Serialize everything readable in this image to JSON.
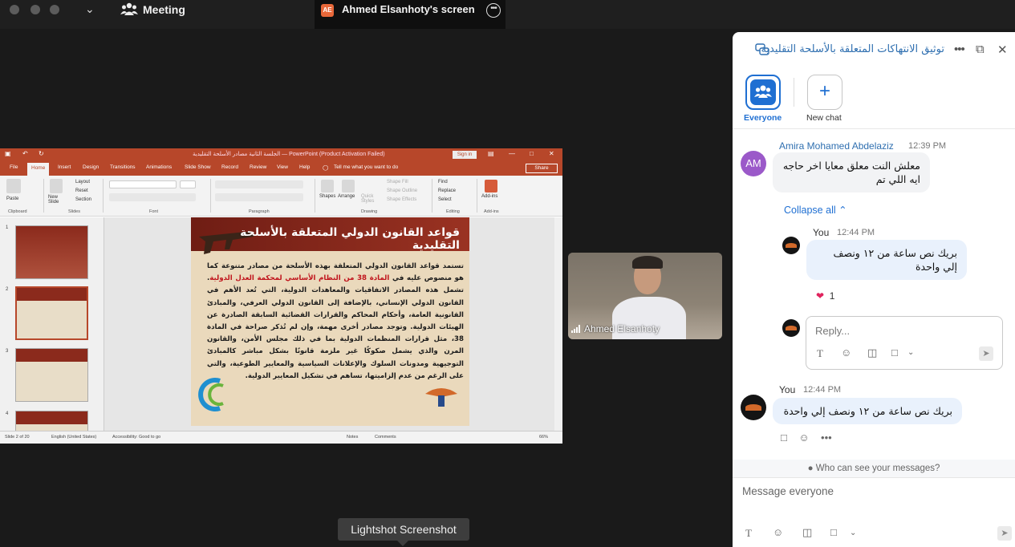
{
  "topbar": {
    "meeting_label": "Meeting",
    "screen_badge": "AE",
    "screen_title": "Ahmed Elsanhoty's screen"
  },
  "ppt": {
    "title": "الجلسة الثانية مصادر الأسلحة التقليدية — PowerPoint (Product Activation Failed)",
    "sign_in": "Sign in",
    "tabs": [
      "File",
      "Home",
      "Insert",
      "Design",
      "Transitions",
      "Animations",
      "Slide Show",
      "Record",
      "Review",
      "View",
      "Help"
    ],
    "tell_me": "Tell me what you want to do",
    "share": "Share",
    "ribbon": {
      "paste": "Paste",
      "new_slide": "New Slide",
      "layout": "Layout",
      "reset": "Reset",
      "section": "Section",
      "shapes": "Shapes",
      "arrange": "Arrange",
      "quick_styles": "Quick Styles",
      "shape_fill": "Shape Fill",
      "shape_outline": "Shape Outline",
      "shape_effects": "Shape Effects",
      "find": "Find",
      "replace": "Replace",
      "select": "Select",
      "addins": "Add-ins",
      "groups": [
        "Clipboard",
        "Slides",
        "Font",
        "Paragraph",
        "Drawing",
        "Editing",
        "Add-ins"
      ]
    },
    "thumb_numbers": [
      "1",
      "2",
      "3",
      "4"
    ],
    "slide": {
      "title": "قواعد القانون الدولي المتعلقة بالأسلحة التقليدية",
      "text_a": "تستمد قواعد القانون الدولي المتعلقة بهذه الأسلحة من مصادر متنوعة كما هو منصوص عليه في ",
      "text_red": "المادة 38 من النظام الأساسي لمحكمة العدل الدولية",
      "text_b": ". تشمل هذه المصادر الاتفاقيات والمعاهدات الدولية، التي تُعد الأهم في القانون الدولي الإنساني، بالإضافة إلى القانون الدولي العرفي، والمبادئ القانونية العامة، وأحكام المحاكم والقرارات القضائية السابقة الصادرة عن الهيئات الدولية. وتوجد مصادر أخرى مهمة، وإن لم تُذكر صراحة في المادة 38، مثل قرارات المنظمات الدولية بما في ذلك مجلس الأمن، والقانون المرن والذي يشمل صكوكًا غير ملزمة قانونًا بشكل مباشر كالمبادئ التوجيهية ومدونات السلوك والإعلانات السياسية والمعايير الطوعية، والتي على الرغم من عدم إلزاميتها، تساهم في تشكيل المعايير الدولية."
    },
    "status": {
      "slide_of": "Slide 2 of 20",
      "language": "English (United States)",
      "accessibility": "Accessibility: Good to go",
      "notes": "Notes",
      "comments": "Comments",
      "zoom": "66%"
    }
  },
  "video": {
    "name": "Ahmed Elsanhoty"
  },
  "tooltip": "Lightshot Screenshot",
  "chat": {
    "title": "توثيق الانتهاكات المتعلقة بالأسلحة التقليدية",
    "tiles": {
      "everyone": "Everyone",
      "new_chat": "New chat"
    },
    "message1": {
      "avatar": "AM",
      "sender": "Amira Mohamed Abdelaziz",
      "time": "12:39 PM",
      "text": "معلش النت معلق معايا اخر حاجه ايه اللي تم"
    },
    "collapse": "Collapse all",
    "reply1": {
      "sender": "You",
      "time": "12:44 PM",
      "text": "بريك نص ساعة من ١٢ ونصف إلي واحدة",
      "reaction_count": "1"
    },
    "reply_placeholder": "Reply...",
    "message2": {
      "sender": "You",
      "time": "12:44 PM",
      "text": "بريك نص ساعة من ١٢ ونصف إلي واحدة"
    },
    "privacy": "Who can see your messages?",
    "compose_placeholder": "Message everyone"
  }
}
